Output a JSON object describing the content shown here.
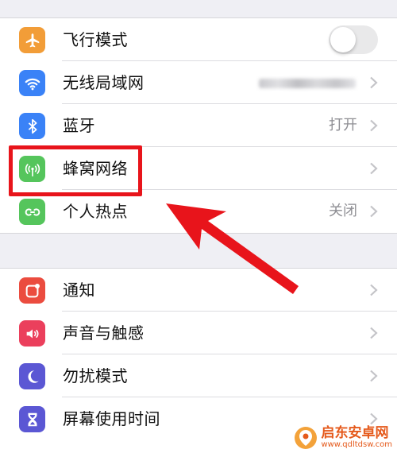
{
  "group1": [
    {
      "id": "airplane",
      "label": "飞行模式",
      "icon": "airplane-icon",
      "color": "#f29d38",
      "control": "toggle",
      "toggle_on": false
    },
    {
      "id": "wifi",
      "label": "无线局域网",
      "icon": "wifi-icon",
      "color": "#3a82f7",
      "control": "chevron",
      "value": ""
    },
    {
      "id": "bluetooth",
      "label": "蓝牙",
      "icon": "bluetooth-icon",
      "color": "#3a82f7",
      "control": "chevron",
      "value": "打开"
    },
    {
      "id": "cellular",
      "label": "蜂窝网络",
      "icon": "cellular-icon",
      "color": "#55c55c",
      "control": "chevron",
      "value": ""
    },
    {
      "id": "hotspot",
      "label": "个人热点",
      "icon": "hotspot-icon",
      "color": "#55c55c",
      "control": "chevron",
      "value": "关闭"
    }
  ],
  "group2": [
    {
      "id": "notifications",
      "label": "通知",
      "icon": "notifications-icon",
      "color": "#eb4c3f",
      "control": "chevron"
    },
    {
      "id": "sounds",
      "label": "声音与触感",
      "icon": "speaker-icon",
      "color": "#eb3f5c",
      "control": "chevron"
    },
    {
      "id": "dnd",
      "label": "勿扰模式",
      "icon": "moon-icon",
      "color": "#5b57d4",
      "control": "chevron"
    },
    {
      "id": "screentime",
      "label": "屏幕使用时间",
      "icon": "hourglass-icon",
      "color": "#5b57d4",
      "control": "chevron"
    }
  ],
  "annotation": {
    "highlight_color": "#e8141b",
    "arrow_color": "#e8141b"
  },
  "watermark": {
    "name": "启东安卓网",
    "url": "www.qdltdsw.com"
  }
}
